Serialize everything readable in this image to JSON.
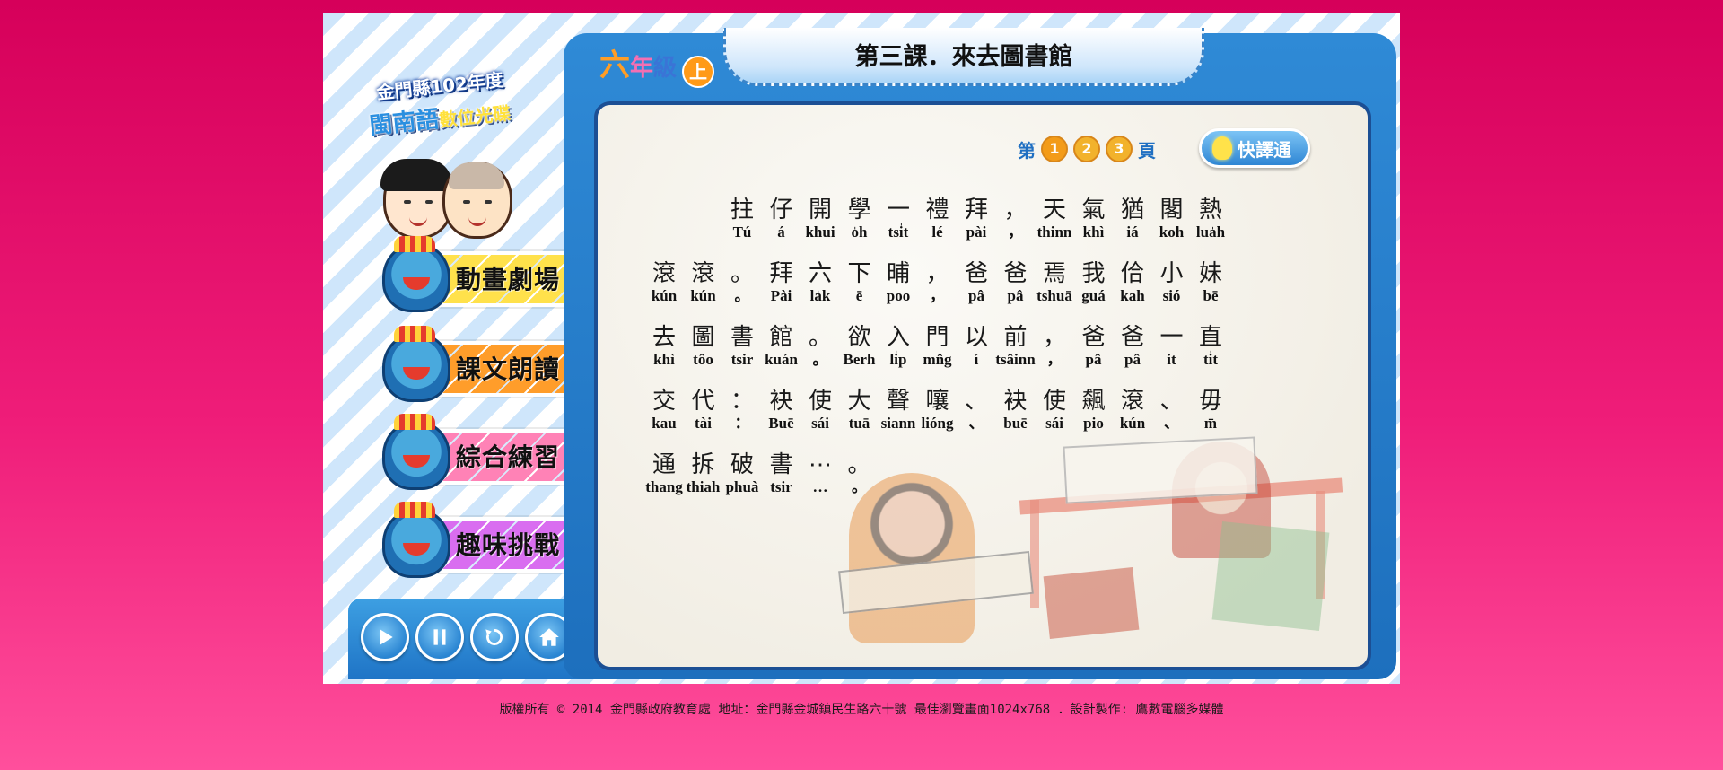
{
  "logo": {
    "title": "金門縣102年度",
    "subtitle_main": "閩南語",
    "subtitle_accent": "數位光碟"
  },
  "menu": [
    {
      "label": "動畫劇場",
      "color": "#ffe14b"
    },
    {
      "label": "課文朗讀",
      "color": "#ff9d2a"
    },
    {
      "label": "綜合練習",
      "color": "#ff82b6"
    },
    {
      "label": "趣味挑戰",
      "color": "#d96df0"
    }
  ],
  "controls": [
    "play-icon",
    "pause-icon",
    "replay-icon",
    "home-icon"
  ],
  "header": {
    "grade_num": "六",
    "grade_a": "年",
    "grade_b": "級",
    "semester": "上",
    "lesson_title": "第三課．來去圖書館"
  },
  "pager": {
    "prefix": "第",
    "pages": [
      "1",
      "2",
      "3"
    ],
    "suffix": "頁",
    "current": "1"
  },
  "quick_button": {
    "label": "快譯通"
  },
  "text_lines": [
    {
      "indent": 2,
      "tokens": [
        {
          "hz": "拄",
          "py": "Tú"
        },
        {
          "hz": "仔",
          "py": "á"
        },
        {
          "hz": "開",
          "py": "khui"
        },
        {
          "hz": "學",
          "py": "o̍h"
        },
        {
          "hz": "一",
          "py": "tsi̍t"
        },
        {
          "hz": "禮",
          "py": "lé"
        },
        {
          "hz": "拜",
          "py": "pài"
        },
        {
          "hz": "，",
          "py": "，"
        },
        {
          "hz": "天",
          "py": "thinn"
        },
        {
          "hz": "氣",
          "py": "khì"
        },
        {
          "hz": "猶",
          "py": "iá"
        },
        {
          "hz": "閣",
          "py": "koh"
        },
        {
          "hz": "熱",
          "py": "lua̍h"
        }
      ]
    },
    {
      "indent": 0,
      "tokens": [
        {
          "hz": "滾",
          "py": "kún"
        },
        {
          "hz": "滾",
          "py": "kún"
        },
        {
          "hz": "。",
          "py": "。"
        },
        {
          "hz": "拜",
          "py": "Pài"
        },
        {
          "hz": "六",
          "py": "la̍k"
        },
        {
          "hz": "下",
          "py": "ē"
        },
        {
          "hz": "晡",
          "py": "poo"
        },
        {
          "hz": "，",
          "py": "，"
        },
        {
          "hz": "爸",
          "py": "pâ"
        },
        {
          "hz": "爸",
          "py": "pâ"
        },
        {
          "hz": "焉",
          "py": "tshuā"
        },
        {
          "hz": "我",
          "py": "guá"
        },
        {
          "hz": "佮",
          "py": "kah"
        },
        {
          "hz": "小",
          "py": "sió"
        },
        {
          "hz": "妹",
          "py": "bē"
        }
      ]
    },
    {
      "indent": 0,
      "tokens": [
        {
          "hz": "去",
          "py": "khì"
        },
        {
          "hz": "圖",
          "py": "tôo"
        },
        {
          "hz": "書",
          "py": "tsir"
        },
        {
          "hz": "館",
          "py": "kuán"
        },
        {
          "hz": "。",
          "py": "。"
        },
        {
          "hz": "欲",
          "py": "Berh"
        },
        {
          "hz": "入",
          "py": "li̍p"
        },
        {
          "hz": "門",
          "py": "mn̂g"
        },
        {
          "hz": "以",
          "py": "í"
        },
        {
          "hz": "前",
          "py": "tsâinn"
        },
        {
          "hz": "，",
          "py": "，"
        },
        {
          "hz": "爸",
          "py": "pâ"
        },
        {
          "hz": "爸",
          "py": "pâ"
        },
        {
          "hz": "一",
          "py": "it"
        },
        {
          "hz": "直",
          "py": "ti̍t"
        }
      ]
    },
    {
      "indent": 0,
      "tokens": [
        {
          "hz": "交",
          "py": "kau"
        },
        {
          "hz": "代",
          "py": "tài"
        },
        {
          "hz": "：",
          "py": "："
        },
        {
          "hz": "袂",
          "py": "Buē"
        },
        {
          "hz": "使",
          "py": "sái"
        },
        {
          "hz": "大",
          "py": "tuā"
        },
        {
          "hz": "聲",
          "py": "siann"
        },
        {
          "hz": "嚷",
          "py": "lióng"
        },
        {
          "hz": "、",
          "py": "、"
        },
        {
          "hz": "袂",
          "py": "buē"
        },
        {
          "hz": "使",
          "py": "sái"
        },
        {
          "hz": "飆",
          "py": "pio"
        },
        {
          "hz": "滾",
          "py": "kún"
        },
        {
          "hz": "、",
          "py": "、"
        },
        {
          "hz": "毋",
          "py": "m̄"
        }
      ]
    },
    {
      "indent": 0,
      "tokens": [
        {
          "hz": "通",
          "py": "thang"
        },
        {
          "hz": "拆",
          "py": "thiah"
        },
        {
          "hz": "破",
          "py": "phuà"
        },
        {
          "hz": "書",
          "py": "tsir"
        },
        {
          "hz": "⋯",
          "py": "…"
        },
        {
          "hz": "。",
          "py": "。"
        }
      ]
    }
  ],
  "footer": "版權所有 © 2014 金門縣政府教育處  地址：金門縣金城鎮民生路六十號 最佳瀏覽畫面1024x768 ．設計製作: 鷹數電腦多媒體"
}
